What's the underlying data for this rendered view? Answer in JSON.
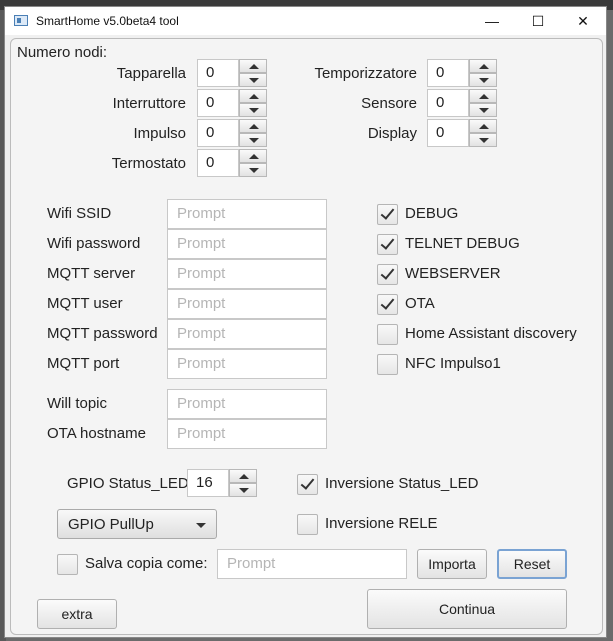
{
  "window": {
    "title": "SmartHome v5.0beta4 tool",
    "minimize_glyph": "—",
    "maximize_glyph": "☐",
    "close_glyph": "✕"
  },
  "nodes": {
    "heading": "Numero nodi:",
    "tapparella": {
      "label": "Tapparella",
      "value": "0"
    },
    "interruttore": {
      "label": "Interruttore",
      "value": "0"
    },
    "impulso": {
      "label": "Impulso",
      "value": "0"
    },
    "termostato": {
      "label": "Termostato",
      "value": "0"
    },
    "temporizzatore": {
      "label": "Temporizzatore",
      "value": "0"
    },
    "sensore": {
      "label": "Sensore",
      "value": "0"
    },
    "display": {
      "label": "Display",
      "value": "0"
    }
  },
  "fields": {
    "wifi_ssid": {
      "label": "Wifi SSID",
      "placeholder": "Prompt"
    },
    "wifi_password": {
      "label": "Wifi password",
      "placeholder": "Prompt"
    },
    "mqtt_server": {
      "label": "MQTT server",
      "placeholder": "Prompt"
    },
    "mqtt_user": {
      "label": "MQTT user",
      "placeholder": "Prompt"
    },
    "mqtt_password": {
      "label": "MQTT password",
      "placeholder": "Prompt"
    },
    "mqtt_port": {
      "label": "MQTT port",
      "placeholder": "Prompt"
    },
    "will_topic": {
      "label": "Will topic",
      "placeholder": "Prompt"
    },
    "ota_hostname": {
      "label": "OTA hostname",
      "placeholder": "Prompt"
    }
  },
  "options": {
    "debug": {
      "label": "DEBUG",
      "checked": true
    },
    "telnet_debug": {
      "label": "TELNET DEBUG",
      "checked": true
    },
    "webserver": {
      "label": "WEBSERVER",
      "checked": true
    },
    "ota": {
      "label": "OTA",
      "checked": true
    },
    "ha_discovery": {
      "label": "Home Assistant discovery",
      "checked": false
    },
    "nfc_impulso1": {
      "label": "NFC Impulso1",
      "checked": false
    }
  },
  "gpio": {
    "status_led_label": "GPIO Status_LED",
    "status_led_value": "16",
    "inversione_status_led": {
      "label": "Inversione Status_LED",
      "checked": true
    },
    "pullup_selected": "GPIO PullUp",
    "inversione_rele": {
      "label": "Inversione RELE",
      "checked": false
    }
  },
  "save": {
    "label": "Salva copia come:",
    "checked": false,
    "placeholder": "Prompt",
    "importa_label": "Importa",
    "reset_label": "Reset"
  },
  "footer": {
    "extra_label": "extra",
    "continua_label": "Continua"
  }
}
